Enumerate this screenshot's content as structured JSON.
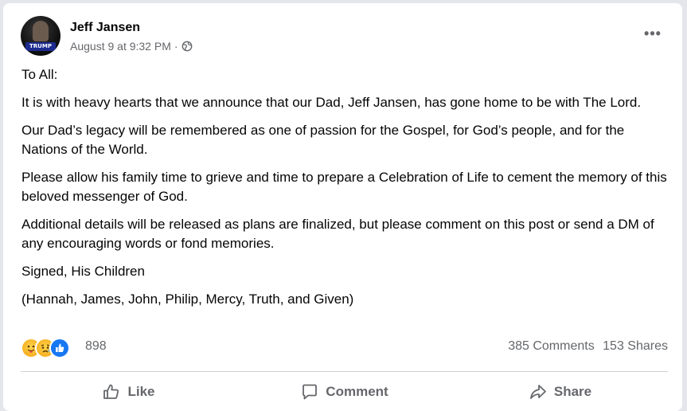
{
  "post": {
    "author": "Jeff Jansen",
    "avatar_text": "TRUMP",
    "timestamp": "August 9 at 9:32 PM",
    "separator": "·",
    "privacy_icon": "globe-icon",
    "more_label": "•••",
    "paragraphs": [
      "To All:",
      "It is with heavy hearts that we announce that our Dad, Jeff Jansen, has gone home to be with The Lord.",
      "Our Dad’s legacy will be remembered as one of passion for the Gospel, for God’s people, and for the Nations of the World.",
      "Please allow his family time to grieve and time to prepare a Celebration of Life to cement the memory of this beloved messenger of God.",
      "Additional details will be released as plans are finalized, but please comment on this post or send a DM of any encouraging words or fond memories.",
      "Signed, His Children",
      "(Hannah, James, John, Philip, Mercy, Truth, and Given)"
    ]
  },
  "stats": {
    "reaction_icons": [
      "care-icon",
      "sad-icon",
      "like-reaction-icon"
    ],
    "reaction_count": "898",
    "comments": "385 Comments",
    "shares": "153 Shares"
  },
  "actions": {
    "like": "Like",
    "comment": "Comment",
    "share": "Share"
  },
  "colors": {
    "background": "#e4e6eb",
    "card": "#ffffff",
    "text": "#050505",
    "secondary_text": "#65676b",
    "like_blue": "#1877f2"
  }
}
